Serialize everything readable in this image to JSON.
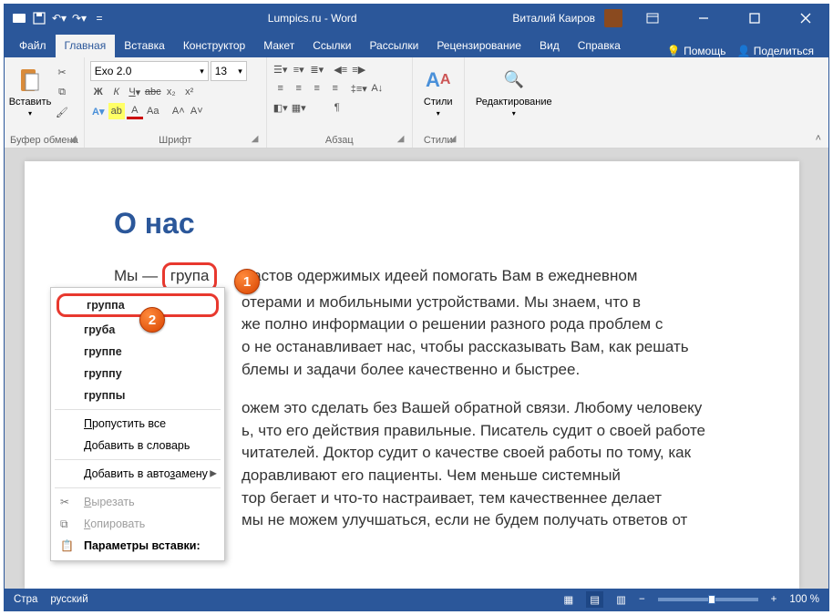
{
  "titlebar": {
    "title": "Lumpics.ru - Word",
    "user": "Виталий Каиров"
  },
  "tabs": {
    "file": "Файл",
    "items": [
      "Главная",
      "Вставка",
      "Конструктор",
      "Макет",
      "Ссылки",
      "Рассылки",
      "Рецензирование",
      "Вид",
      "Справка"
    ],
    "help": "Помощь",
    "share": "Поделиться",
    "activeIndex": 0
  },
  "ribbon": {
    "clipboard": {
      "label": "Буфер обмена",
      "paste": "Вставить"
    },
    "font": {
      "label": "Шрифт",
      "name": "Exo 2.0",
      "size": "13",
      "bold": "Ж",
      "italic": "К",
      "underline": "Ч",
      "strike": "abc",
      "sub": "x₂",
      "sup": "x²",
      "text_fill": "A",
      "highlight": "ab",
      "color": "A",
      "case": "Aa",
      "grow": "A˄",
      "shrink": "A˅"
    },
    "paragraph": {
      "label": "Абзац"
    },
    "styles": {
      "label": "Стили",
      "button": "Стили"
    },
    "editing": {
      "button": "Редактирование"
    }
  },
  "document": {
    "heading": "О нас",
    "para1_lead": "Мы — ",
    "para1_misspelled": "група",
    "para1_tail_l1": "астов одержимых идеей помогать Вам в ежедневном",
    "para1_tail_l2": "отерами и мобильными устройствами. Мы знаем, что в",
    "para1_tail_l3": "же полно информации о решении разного рода проблем с",
    "para1_tail_l4": "о не останавливает нас, чтобы рассказывать Вам, как решать",
    "para1_tail_l5": "блемы и задачи более качественно и быстрее.",
    "para2_l1": "ожем это сделать без Вашей обратной связи. Любому человеку",
    "para2_l2": "ь, что его действия правильные. Писатель судит о своей работе",
    "para2_l3": "читателей. Доктор судит о качестве своей работы по тому, как",
    "para2_l4": "доравливают его пациенты. Чем меньше системный",
    "para2_l5": "тор бегает и что-то настраивает, тем качественнее делает",
    "para2_l6": "мы не можем улучшаться, если не будем получать ответов от"
  },
  "contextmenu": {
    "suggestions": [
      "группа",
      "груба",
      "группе",
      "группу",
      "группы"
    ],
    "skip_all": "Пропустить все",
    "add_dict": "Добавить в словарь",
    "add_autocorrect": "Добавить в автозамену",
    "cut": "Вырезать",
    "copy": "Копировать",
    "paste_opts": "Параметры вставки:"
  },
  "callouts": {
    "one": "1",
    "two": "2"
  },
  "statusbar": {
    "page": "Стра",
    "language": "русский",
    "zoom": "100 %"
  }
}
